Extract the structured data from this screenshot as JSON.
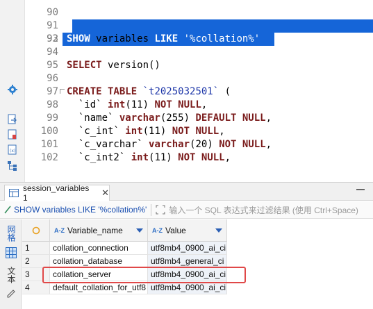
{
  "editor": {
    "line_numbers": [
      "90",
      "91",
      "92",
      "93",
      "94",
      "95",
      "96",
      "97",
      "98",
      "99",
      "100",
      "101",
      "102"
    ],
    "lines": [
      {
        "n": "93",
        "parts": [
          [
            "kw",
            "SHOW"
          ],
          [
            "plain",
            " variables "
          ],
          [
            "kw",
            "LIKE"
          ],
          [
            "str",
            " '%collation%'"
          ]
        ]
      },
      {
        "n": "95",
        "parts": [
          [
            "kw",
            "SELECT"
          ],
          [
            "plain",
            " version()"
          ]
        ]
      },
      {
        "n": "97",
        "parts": [
          [
            "kw",
            "CREATE TABLE"
          ],
          [
            "str",
            " `t2025032501`"
          ],
          [
            "plain",
            " ("
          ]
        ]
      },
      {
        "n": "98",
        "parts": [
          [
            "plain",
            "  `id` "
          ],
          [
            "kw",
            "int"
          ],
          [
            "plain",
            "(11) "
          ],
          [
            "kw",
            "NOT NULL"
          ],
          [
            "plain",
            ","
          ]
        ]
      },
      {
        "n": "99",
        "parts": [
          [
            "plain",
            "  `name` "
          ],
          [
            "kw",
            "varchar"
          ],
          [
            "plain",
            "(255) "
          ],
          [
            "kw",
            "DEFAULT NULL"
          ],
          [
            "plain",
            ","
          ]
        ]
      },
      {
        "n": "100",
        "parts": [
          [
            "plain",
            "  `c_int` "
          ],
          [
            "kw",
            "int"
          ],
          [
            "plain",
            "(11) "
          ],
          [
            "kw",
            "NOT NULL"
          ],
          [
            "plain",
            ","
          ]
        ]
      },
      {
        "n": "101",
        "parts": [
          [
            "plain",
            "  `c_varchar` "
          ],
          [
            "kw",
            "varchar"
          ],
          [
            "plain",
            "(20) "
          ],
          [
            "kw",
            "NOT NULL"
          ],
          [
            "plain",
            ","
          ]
        ]
      },
      {
        "n": "102",
        "parts": [
          [
            "plain",
            "  `c_int2` "
          ],
          [
            "kw",
            "int"
          ],
          [
            "plain",
            "(11) "
          ],
          [
            "kw",
            "NOT NULL"
          ],
          [
            "plain",
            ","
          ]
        ]
      }
    ],
    "selection_color": "#1565d8"
  },
  "left_strip_icons": [
    "gear-icon",
    "export-icon",
    "document-icon",
    "query-doc-icon",
    "structure-icon"
  ],
  "result_panel": {
    "tab_label": "session_variables 1",
    "tab_close": "✕",
    "query_text": "SHOW variables LIKE '%collation%'",
    "filter_placeholder": "输入一个 SQL 表达式来过滤结果 (使用 Ctrl+Space)",
    "side_tab_grid": "网格",
    "side_tab_text": "文本",
    "columns": [
      "Variable_name",
      "Value"
    ],
    "column_prefix": "A-Z",
    "rows": [
      {
        "num": "1",
        "name": "collation_connection",
        "value": "utf8mb4_0900_ai_ci"
      },
      {
        "num": "2",
        "name": "collation_database",
        "value": "utf8mb4_general_ci"
      },
      {
        "num": "3",
        "name": "collation_server",
        "value": "utf8mb4_0900_ai_ci"
      },
      {
        "num": "4",
        "name": "default_collation_for_utf8",
        "value": "utf8mb4_0900_ai_ci"
      }
    ],
    "highlighted_row": "3",
    "highlight_color": "#e04848"
  }
}
